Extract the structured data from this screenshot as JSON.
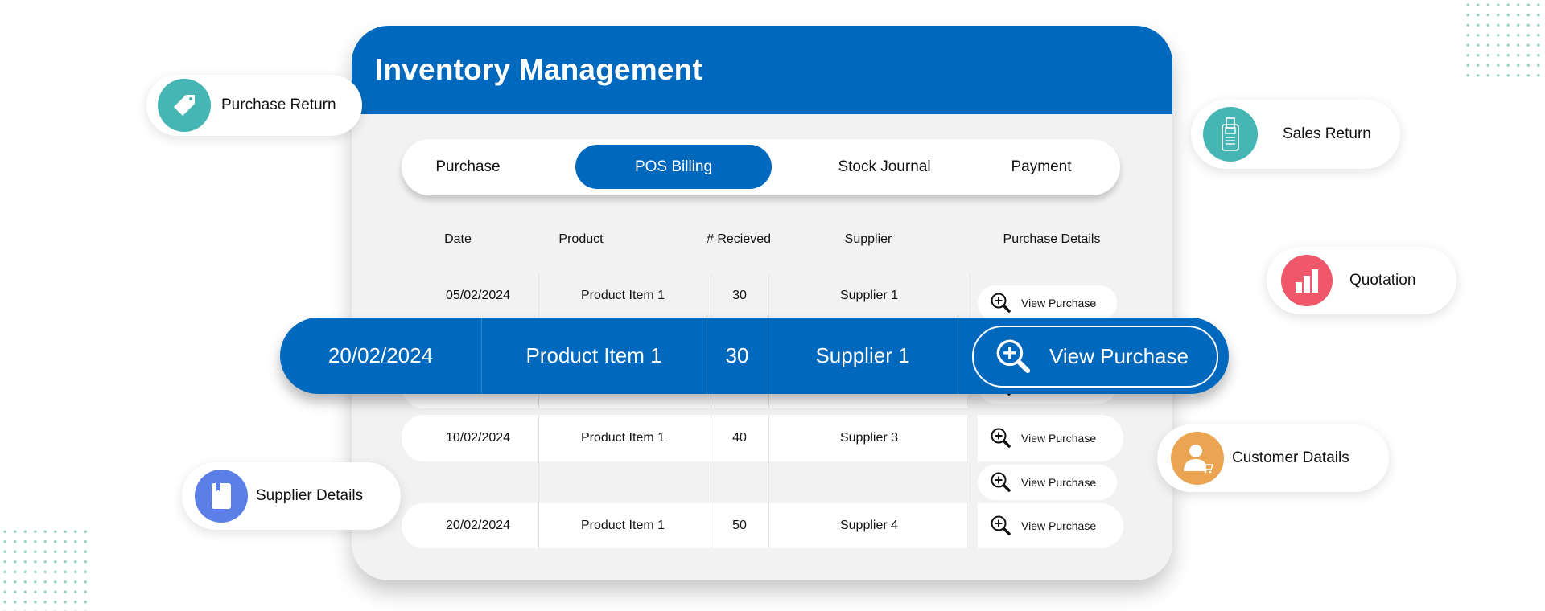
{
  "app": {
    "title": "Inventory Management",
    "accent_color": "#0069bd"
  },
  "tabs": [
    {
      "label": "Purchase",
      "active": false
    },
    {
      "label": "POS Billing",
      "active": true
    },
    {
      "label": "Stock Journal",
      "active": false
    },
    {
      "label": "Payment",
      "active": false
    }
  ],
  "table": {
    "columns": [
      "Date",
      "Product",
      "# Recieved",
      "Supplier",
      "Purchase Details"
    ],
    "rows": [
      {
        "date": "05/02/2024",
        "product": "Product Item 1",
        "received": "30",
        "supplier": "Supplier 1",
        "action": "View Purchase"
      },
      {
        "date": "",
        "product": "",
        "received": "",
        "supplier": "",
        "action": "View Purchase"
      },
      {
        "date": "10/02/2024",
        "product": "Product Item 1",
        "received": "40",
        "supplier": "Supplier 3",
        "action": "View Purchase"
      },
      {
        "date": "",
        "product": "",
        "received": "",
        "supplier": "",
        "action": "View Purchase"
      },
      {
        "date": "20/02/2024",
        "product": "Product Item 1",
        "received": "50",
        "supplier": "Supplier 4",
        "action": "View Purchase"
      }
    ],
    "highlighted_row": {
      "date": "20/02/2024",
      "product": "Product Item 1",
      "received": "30",
      "supplier": "Supplier 1",
      "action": "View Purchase"
    },
    "action_icon": "zoom-in-icon"
  },
  "callouts": {
    "purchase_return": {
      "label": "Purchase Return",
      "icon": "price-tag-icon",
      "color": "#46b6b4"
    },
    "sales_return": {
      "label": "Sales Return",
      "icon": "card-terminal-icon",
      "color": "#46b6b4"
    },
    "quotation": {
      "label": "Quotation",
      "icon": "bar-chart-icon",
      "color": "#f1576b"
    },
    "customer_details": {
      "label": "Customer Datails",
      "icon": "customer-cart-icon",
      "color": "#eaa452"
    },
    "supplier_details": {
      "label": "Supplier Details",
      "icon": "bookmark-book-icon",
      "color": "#5b7fe6"
    }
  }
}
